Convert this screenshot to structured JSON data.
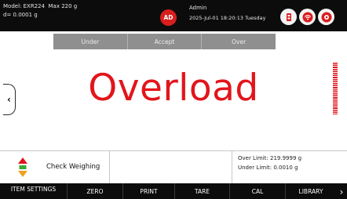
{
  "header": {
    "model": "Model: EXR224",
    "max": "Max 220 g",
    "d": "d= 0.0001 g",
    "avatar_initials": "AD",
    "user": "Admin",
    "datetime": "2025-Jul-01 18:20:13 Tuesday",
    "icons": [
      "printer-usb-icon",
      "wifi-icon",
      "settings-icon"
    ]
  },
  "tabs": [
    {
      "label": "Under"
    },
    {
      "label": "Accept"
    },
    {
      "label": "Over"
    }
  ],
  "display": {
    "reading": "Overload",
    "reading_color": "#e2151b"
  },
  "status": {
    "mode_label": "Check Weighing",
    "over_limit": "Over Limit: 219.9999 g",
    "under_limit": "Under Limit: 0.0010 g"
  },
  "functions": [
    {
      "label": "ITEM SETTINGS"
    },
    {
      "label": "ZERO"
    },
    {
      "label": "PRINT"
    },
    {
      "label": "TARE"
    },
    {
      "label": "CAL"
    },
    {
      "label": "LIBRARY"
    }
  ]
}
